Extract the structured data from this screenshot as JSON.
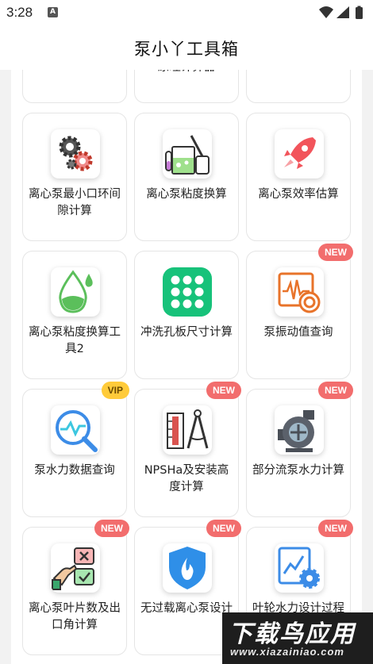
{
  "status_bar": {
    "time": "3:28",
    "notification_icon": "a-icon",
    "icons": [
      "wifi-icon",
      "signal-icon",
      "battery-icon"
    ]
  },
  "app": {
    "title": "泵小丫工具箱"
  },
  "cards": [
    {
      "label": "",
      "icon": "blank"
    },
    {
      "label": "原理计算器",
      "icon": "blank"
    },
    {
      "label": "",
      "icon": "blank"
    },
    {
      "label": "离心泵最小口环间隙计算",
      "icon": "gears-icon"
    },
    {
      "label": "离心泵粘度换算",
      "icon": "lab-beaker-icon"
    },
    {
      "label": "离心泵效率估算",
      "icon": "rocket-icon"
    },
    {
      "label": "离心泵粘度换算工具2",
      "icon": "droplet-icon"
    },
    {
      "label": "冲洗孔板尺寸计算",
      "icon": "orifice-plate-icon",
      "badge": ""
    },
    {
      "label": "泵振动值查询",
      "icon": "vibration-icon",
      "badge": "NEW"
    },
    {
      "label": "泵水力数据查询",
      "icon": "chart-search-icon",
      "badge": "VIP"
    },
    {
      "label": "NPSHa及安装高度计算",
      "icon": "thermometer-compass-icon",
      "badge": "NEW"
    },
    {
      "label": "部分流泵水力计算",
      "icon": "pump-icon",
      "badge": "NEW"
    },
    {
      "label": "离心泵叶片数及出口角计算",
      "icon": "hand-check-icon",
      "badge": "NEW"
    },
    {
      "label": "无过载离心泵设计",
      "icon": "shield-flame-icon",
      "badge": "NEW"
    },
    {
      "label": "叶轮水力设计过程",
      "icon": "chart-gear-icon",
      "badge": "NEW"
    }
  ],
  "watermark": {
    "line1": "下载鸟应用",
    "line2": "www.xiazainiao.com"
  },
  "colors": {
    "new_badge": "#f26d6d",
    "vip_badge": "#ffcb3a",
    "rocket": "#f2545b",
    "green": "#17c27a"
  }
}
